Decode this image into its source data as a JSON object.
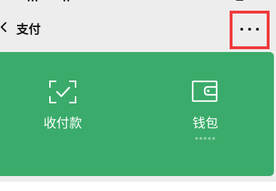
{
  "header": {
    "title": "支付",
    "back_icon": "chevron-left-icon",
    "more_icon": "more-horizontal-icon",
    "highlight_color": "#f0393a"
  },
  "card": {
    "background_color": "#3aab6a",
    "tiles": [
      {
        "label": "收付款",
        "icon": "scan-check-icon"
      },
      {
        "label": "钱包",
        "sub": "*****",
        "icon": "wallet-icon"
      }
    ]
  }
}
